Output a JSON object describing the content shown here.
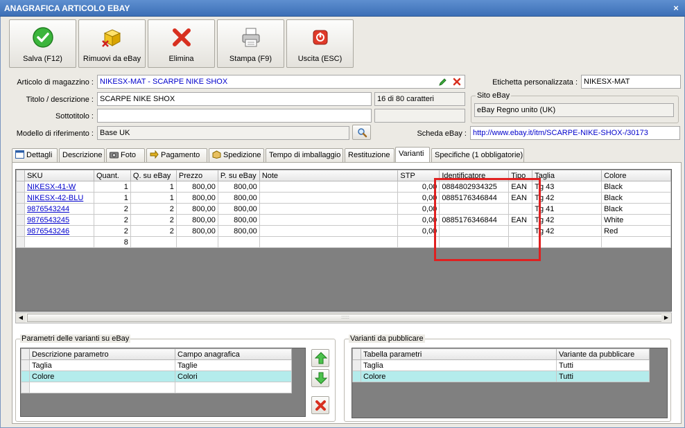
{
  "window": {
    "title": "ANAGRAFICA ARTICOLO EBAY",
    "close_glyph": "×"
  },
  "toolbar": [
    {
      "label": "Salva (F12)",
      "icon": "check-icon"
    },
    {
      "label": "Rimuovi da eBay",
      "icon": "remove-box-icon"
    },
    {
      "label": "Elimina",
      "icon": "delete-x-icon"
    },
    {
      "label": "Stampa (F9)",
      "icon": "printer-icon"
    },
    {
      "label": "Uscita (ESC)",
      "icon": "exit-icon"
    }
  ],
  "form": {
    "articolo_label": "Articolo di magazzino :",
    "articolo_value": "NIKESX-MAT - SCARPE NIKE SHOX",
    "titolo_label": "Titolo / descrizione :",
    "titolo_value": "SCARPE NIKE SHOX",
    "titolo_counter": "16 di 80 caratteri",
    "sottotitolo_label": "Sottotitolo :",
    "sottotitolo_value": "",
    "modello_label": "Modello di riferimento :",
    "modello_value": "Base UK",
    "etichetta_label": "Etichetta personalizzata :",
    "etichetta_value": "NIKESX-MAT",
    "sito_group": "Sito eBay",
    "sito_value": "eBay Regno unito (UK)",
    "scheda_label": "Scheda eBay :",
    "scheda_value": "http://www.ebay.it/itm/SCARPE-NIKE-SHOX-/30173"
  },
  "tabs": [
    {
      "label": "Dettagli"
    },
    {
      "label": "Descrizione"
    },
    {
      "label": "Foto"
    },
    {
      "label": "Pagamento"
    },
    {
      "label": "Spedizione"
    },
    {
      "label": "Tempo di imballaggio"
    },
    {
      "label": "Restituzione"
    },
    {
      "label": "Varianti"
    },
    {
      "label": "Specifiche (1 obbligatorie)"
    }
  ],
  "variants": {
    "columns": [
      "SKU",
      "Quant.",
      "Q. su eBay",
      "Prezzo",
      "P. su eBay",
      "Note",
      "STP",
      "Identificatore",
      "Tipo",
      "Taglia",
      "Colore"
    ],
    "rows": [
      [
        "NIKESX-41-W",
        "1",
        "1",
        "800,00",
        "800,00",
        "",
        "0,00",
        "0884802934325",
        "EAN",
        "Tg 43",
        "Black"
      ],
      [
        "NIKESX-42-BLU",
        "1",
        "1",
        "800,00",
        "800,00",
        "",
        "0,00",
        "0885176346844",
        "EAN",
        "Tg 42",
        "Black"
      ],
      [
        "9876543244",
        "2",
        "2",
        "800,00",
        "800,00",
        "",
        "0,00",
        "",
        "",
        "Tg 41",
        "Black"
      ],
      [
        "9876543245",
        "2",
        "2",
        "800,00",
        "800,00",
        "",
        "0,00",
        "0885176346844",
        "EAN",
        "Tg 42",
        "White"
      ],
      [
        "9876543246",
        "2",
        "2",
        "800,00",
        "800,00",
        "",
        "0,00",
        "",
        "",
        "Tg 42",
        "Red"
      ]
    ],
    "total_quant": "8"
  },
  "params": {
    "group_title": "Parametri delle varianti su eBay",
    "columns": [
      "Descrizione parametro",
      "Campo anagrafica"
    ],
    "rows": [
      [
        "Taglia",
        "Taglie"
      ],
      [
        "Colore",
        "Colori"
      ]
    ]
  },
  "publish": {
    "group_title": "Varianti da pubblicare",
    "columns": [
      "Tabella parametri",
      "Variante da pubblicare"
    ],
    "rows": [
      [
        "Taglia",
        "Tutti"
      ],
      [
        "Colore",
        "Tutti"
      ]
    ]
  },
  "colors": {
    "title_bar": "#3c6fb6",
    "link": "#0000cc",
    "highlight_box": "#e02020",
    "selected_row": "#b4ecec"
  }
}
